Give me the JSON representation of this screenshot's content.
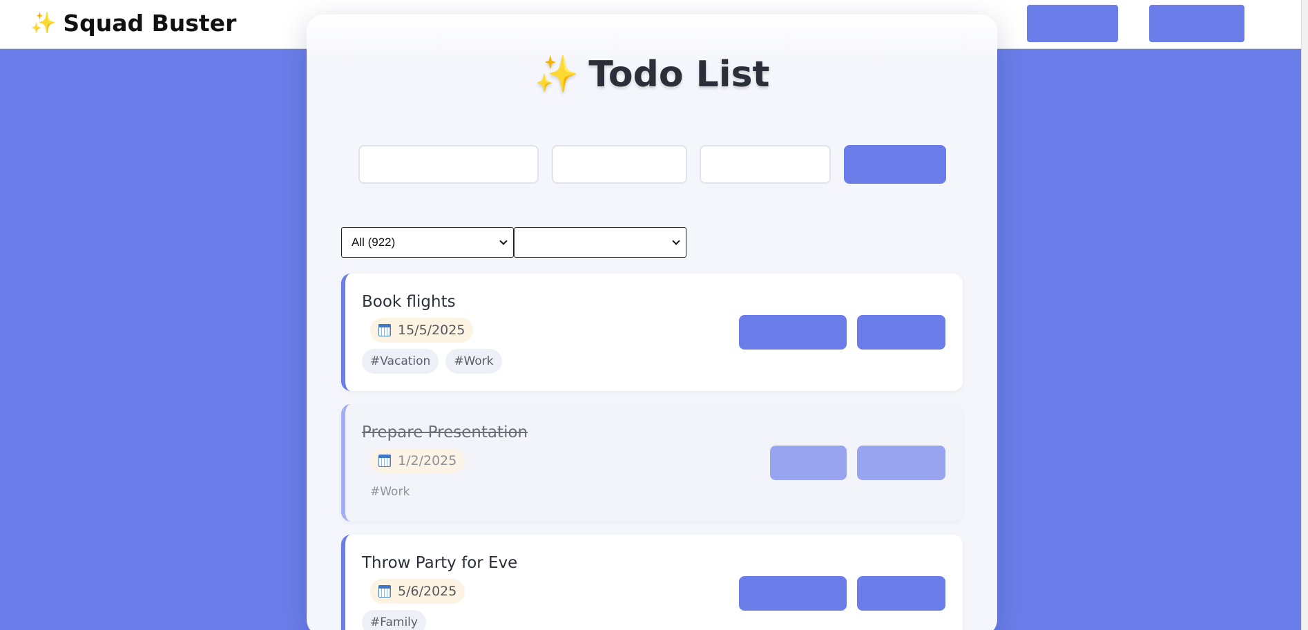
{
  "app": {
    "brand_icon": "sparkles-icon",
    "brand_icon_glyph": "✨",
    "brand_name": "Squad Buster"
  },
  "header": {
    "nav_button_1_label": "",
    "nav_button_2_label": ""
  },
  "page": {
    "title_icon_glyph": "✨",
    "title": "Todo List"
  },
  "form": {
    "task_placeholder": "",
    "date_placeholder": "",
    "tags_placeholder": "",
    "add_label": ""
  },
  "filters": {
    "status_selected": "All (922)",
    "tag_selected": ""
  },
  "todos": [
    {
      "title": "Book flights",
      "date": "15/5/2025",
      "tags": [
        "#Vacation",
        "#Work"
      ],
      "completed": false,
      "edit_label": "",
      "delete_label": ""
    },
    {
      "title": "Prepare Presentation",
      "date": "1/2/2025",
      "tags": [
        "#Work"
      ],
      "completed": true,
      "edit_label": "",
      "delete_label": ""
    },
    {
      "title": "Throw Party for Eve",
      "date": "5/6/2025",
      "tags": [
        "#Family"
      ],
      "completed": false,
      "edit_label": "",
      "delete_label": ""
    }
  ],
  "colors": {
    "accent": "#6a7de9",
    "accent_faded": "#98a4f0",
    "page_background": "#6a7de9",
    "panel_background": "#f5f6fb",
    "date_pill": "#fdf3e2"
  }
}
